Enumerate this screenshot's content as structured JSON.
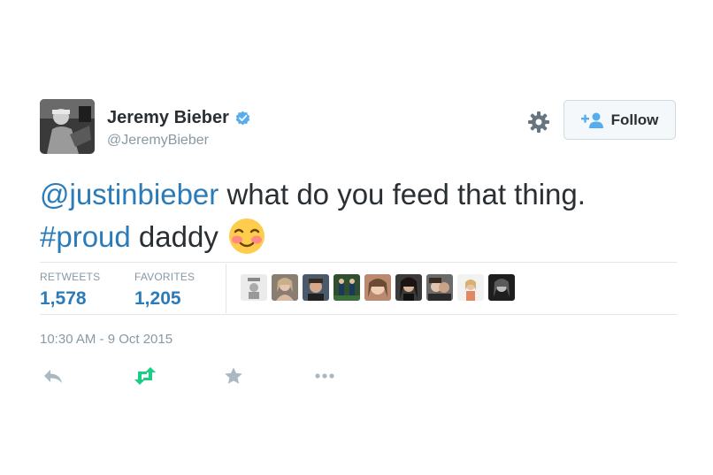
{
  "user": {
    "display_name": "Jeremy Bieber",
    "handle": "@JeremyBieber",
    "verified": true,
    "avatar_icon": "profile-photo"
  },
  "follow_button": {
    "label": "Follow",
    "icon": "add-user-icon"
  },
  "settings_icon": "gear-icon",
  "tweet": {
    "mention": "@justinbieber",
    "text_1": " what do you feed that thing.",
    "hashtag": "#proud",
    "text_2": " daddy",
    "emoji": "smiling-face-with-blush"
  },
  "stats": {
    "retweets_label": "RETWEETS",
    "retweets_value": "1,578",
    "favorites_label": "FAVORITES",
    "favorites_value": "1,205"
  },
  "favoriters_count_shown": 9,
  "timestamp": "10:30 AM - 9 Oct 2015",
  "actions": [
    "reply-icon",
    "retweet-icon",
    "favorite-icon",
    "more-icon"
  ],
  "colors": {
    "link": "#2b7bb9",
    "muted": "#8899a6",
    "text": "#292f33",
    "retweet_green": "#19cf86",
    "verified_blue": "#55acee"
  }
}
